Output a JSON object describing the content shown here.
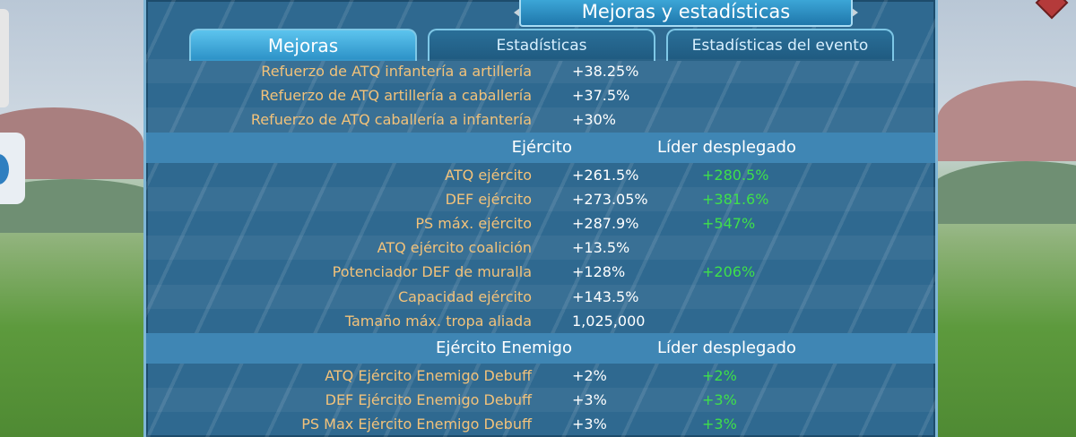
{
  "title": "Mejoras y estadísticas",
  "tabs": [
    {
      "label": "Mejoras",
      "active": true
    },
    {
      "label": "Estadísticas",
      "active": false
    },
    {
      "label": "Estadísticas del evento",
      "active": false
    }
  ],
  "rows": [
    {
      "label": "Refuerzo de ATQ infantería a artillería",
      "value": "+38.25%",
      "leader": ""
    },
    {
      "label": "Refuerzo de ATQ artillería a caballería",
      "value": "+37.5%",
      "leader": ""
    },
    {
      "label": "Refuerzo de ATQ caballería a infantería",
      "value": "+30%",
      "leader": ""
    },
    {
      "header": true,
      "label": "Ejército",
      "leader": "Líder desplegado"
    },
    {
      "label": "ATQ ejército",
      "value": "+261.5%",
      "leader": "+280.5%"
    },
    {
      "label": "DEF ejército",
      "value": "+273.05%",
      "leader": "+381.6%"
    },
    {
      "label": "PS máx. ejército",
      "value": "+287.9%",
      "leader": "+547%"
    },
    {
      "label": "ATQ ejército coalición",
      "value": "+13.5%",
      "leader": ""
    },
    {
      "label": "Potenciador DEF de muralla",
      "value": "+128%",
      "leader": "+206%"
    },
    {
      "label": "Capacidad ejército",
      "value": "+143.5%",
      "leader": ""
    },
    {
      "label": "Tamaño máx. tropa aliada",
      "value": "1,025,000",
      "leader": ""
    },
    {
      "header": true,
      "label": "Ejército Enemigo",
      "leader": "Líder desplegado"
    },
    {
      "label": "ATQ Ejército Enemigo Debuff",
      "value": "+2%",
      "leader": "+2%"
    },
    {
      "label": "DEF Ejército Enemigo Debuff",
      "value": "+3%",
      "leader": "+3%"
    },
    {
      "label": "PS Max Ejército Enemigo Debuff",
      "value": "+3%",
      "leader": "+3%"
    }
  ],
  "colors": {
    "label": "#f2c27a",
    "value": "#ffffff",
    "leader_value": "#3fe04a",
    "panel": "#2f6990",
    "active_tab": "#3ea9da"
  },
  "icons": {
    "title_left": "arrow-left-icon",
    "title_right": "arrow-right-icon"
  }
}
